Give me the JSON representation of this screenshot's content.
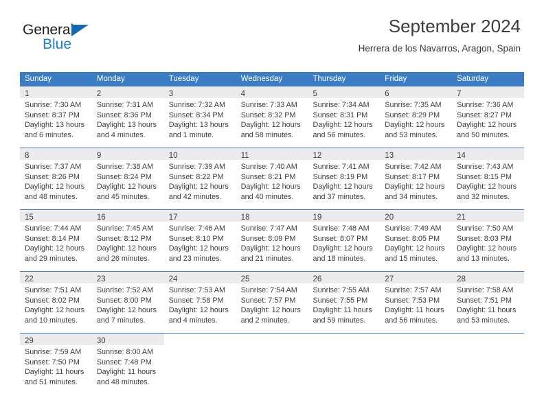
{
  "brand": {
    "name_part1": "General",
    "name_part2": "Blue",
    "triangle_color": "#1268b3",
    "blue_color": "#1b7fd4"
  },
  "header": {
    "title": "September 2024",
    "subtitle": "Herrera de los Navarros, Aragon, Spain"
  },
  "theme": {
    "header_bg": "#3b7dc4",
    "daynum_bg": "#ebebeb",
    "text": "#3d3d3d"
  },
  "weekdays": [
    "Sunday",
    "Monday",
    "Tuesday",
    "Wednesday",
    "Thursday",
    "Friday",
    "Saturday"
  ],
  "weeks": [
    [
      {
        "day": "1",
        "sunrise": "Sunrise: 7:30 AM",
        "sunset": "Sunset: 8:37 PM",
        "daylight1": "Daylight: 13 hours",
        "daylight2": "and 6 minutes."
      },
      {
        "day": "2",
        "sunrise": "Sunrise: 7:31 AM",
        "sunset": "Sunset: 8:36 PM",
        "daylight1": "Daylight: 13 hours",
        "daylight2": "and 4 minutes."
      },
      {
        "day": "3",
        "sunrise": "Sunrise: 7:32 AM",
        "sunset": "Sunset: 8:34 PM",
        "daylight1": "Daylight: 13 hours",
        "daylight2": "and 1 minute."
      },
      {
        "day": "4",
        "sunrise": "Sunrise: 7:33 AM",
        "sunset": "Sunset: 8:32 PM",
        "daylight1": "Daylight: 12 hours",
        "daylight2": "and 58 minutes."
      },
      {
        "day": "5",
        "sunrise": "Sunrise: 7:34 AM",
        "sunset": "Sunset: 8:31 PM",
        "daylight1": "Daylight: 12 hours",
        "daylight2": "and 56 minutes."
      },
      {
        "day": "6",
        "sunrise": "Sunrise: 7:35 AM",
        "sunset": "Sunset: 8:29 PM",
        "daylight1": "Daylight: 12 hours",
        "daylight2": "and 53 minutes."
      },
      {
        "day": "7",
        "sunrise": "Sunrise: 7:36 AM",
        "sunset": "Sunset: 8:27 PM",
        "daylight1": "Daylight: 12 hours",
        "daylight2": "and 50 minutes."
      }
    ],
    [
      {
        "day": "8",
        "sunrise": "Sunrise: 7:37 AM",
        "sunset": "Sunset: 8:26 PM",
        "daylight1": "Daylight: 12 hours",
        "daylight2": "and 48 minutes."
      },
      {
        "day": "9",
        "sunrise": "Sunrise: 7:38 AM",
        "sunset": "Sunset: 8:24 PM",
        "daylight1": "Daylight: 12 hours",
        "daylight2": "and 45 minutes."
      },
      {
        "day": "10",
        "sunrise": "Sunrise: 7:39 AM",
        "sunset": "Sunset: 8:22 PM",
        "daylight1": "Daylight: 12 hours",
        "daylight2": "and 42 minutes."
      },
      {
        "day": "11",
        "sunrise": "Sunrise: 7:40 AM",
        "sunset": "Sunset: 8:21 PM",
        "daylight1": "Daylight: 12 hours",
        "daylight2": "and 40 minutes."
      },
      {
        "day": "12",
        "sunrise": "Sunrise: 7:41 AM",
        "sunset": "Sunset: 8:19 PM",
        "daylight1": "Daylight: 12 hours",
        "daylight2": "and 37 minutes."
      },
      {
        "day": "13",
        "sunrise": "Sunrise: 7:42 AM",
        "sunset": "Sunset: 8:17 PM",
        "daylight1": "Daylight: 12 hours",
        "daylight2": "and 34 minutes."
      },
      {
        "day": "14",
        "sunrise": "Sunrise: 7:43 AM",
        "sunset": "Sunset: 8:15 PM",
        "daylight1": "Daylight: 12 hours",
        "daylight2": "and 32 minutes."
      }
    ],
    [
      {
        "day": "15",
        "sunrise": "Sunrise: 7:44 AM",
        "sunset": "Sunset: 8:14 PM",
        "daylight1": "Daylight: 12 hours",
        "daylight2": "and 29 minutes."
      },
      {
        "day": "16",
        "sunrise": "Sunrise: 7:45 AM",
        "sunset": "Sunset: 8:12 PM",
        "daylight1": "Daylight: 12 hours",
        "daylight2": "and 26 minutes."
      },
      {
        "day": "17",
        "sunrise": "Sunrise: 7:46 AM",
        "sunset": "Sunset: 8:10 PM",
        "daylight1": "Daylight: 12 hours",
        "daylight2": "and 23 minutes."
      },
      {
        "day": "18",
        "sunrise": "Sunrise: 7:47 AM",
        "sunset": "Sunset: 8:09 PM",
        "daylight1": "Daylight: 12 hours",
        "daylight2": "and 21 minutes."
      },
      {
        "day": "19",
        "sunrise": "Sunrise: 7:48 AM",
        "sunset": "Sunset: 8:07 PM",
        "daylight1": "Daylight: 12 hours",
        "daylight2": "and 18 minutes."
      },
      {
        "day": "20",
        "sunrise": "Sunrise: 7:49 AM",
        "sunset": "Sunset: 8:05 PM",
        "daylight1": "Daylight: 12 hours",
        "daylight2": "and 15 minutes."
      },
      {
        "day": "21",
        "sunrise": "Sunrise: 7:50 AM",
        "sunset": "Sunset: 8:03 PM",
        "daylight1": "Daylight: 12 hours",
        "daylight2": "and 13 minutes."
      }
    ],
    [
      {
        "day": "22",
        "sunrise": "Sunrise: 7:51 AM",
        "sunset": "Sunset: 8:02 PM",
        "daylight1": "Daylight: 12 hours",
        "daylight2": "and 10 minutes."
      },
      {
        "day": "23",
        "sunrise": "Sunrise: 7:52 AM",
        "sunset": "Sunset: 8:00 PM",
        "daylight1": "Daylight: 12 hours",
        "daylight2": "and 7 minutes."
      },
      {
        "day": "24",
        "sunrise": "Sunrise: 7:53 AM",
        "sunset": "Sunset: 7:58 PM",
        "daylight1": "Daylight: 12 hours",
        "daylight2": "and 4 minutes."
      },
      {
        "day": "25",
        "sunrise": "Sunrise: 7:54 AM",
        "sunset": "Sunset: 7:57 PM",
        "daylight1": "Daylight: 12 hours",
        "daylight2": "and 2 minutes."
      },
      {
        "day": "26",
        "sunrise": "Sunrise: 7:55 AM",
        "sunset": "Sunset: 7:55 PM",
        "daylight1": "Daylight: 11 hours",
        "daylight2": "and 59 minutes."
      },
      {
        "day": "27",
        "sunrise": "Sunrise: 7:57 AM",
        "sunset": "Sunset: 7:53 PM",
        "daylight1": "Daylight: 11 hours",
        "daylight2": "and 56 minutes."
      },
      {
        "day": "28",
        "sunrise": "Sunrise: 7:58 AM",
        "sunset": "Sunset: 7:51 PM",
        "daylight1": "Daylight: 11 hours",
        "daylight2": "and 53 minutes."
      }
    ],
    [
      {
        "day": "29",
        "sunrise": "Sunrise: 7:59 AM",
        "sunset": "Sunset: 7:50 PM",
        "daylight1": "Daylight: 11 hours",
        "daylight2": "and 51 minutes."
      },
      {
        "day": "30",
        "sunrise": "Sunrise: 8:00 AM",
        "sunset": "Sunset: 7:48 PM",
        "daylight1": "Daylight: 11 hours",
        "daylight2": "and 48 minutes."
      },
      {
        "day": "",
        "sunrise": "",
        "sunset": "",
        "daylight1": "",
        "daylight2": ""
      },
      {
        "day": "",
        "sunrise": "",
        "sunset": "",
        "daylight1": "",
        "daylight2": ""
      },
      {
        "day": "",
        "sunrise": "",
        "sunset": "",
        "daylight1": "",
        "daylight2": ""
      },
      {
        "day": "",
        "sunrise": "",
        "sunset": "",
        "daylight1": "",
        "daylight2": ""
      },
      {
        "day": "",
        "sunrise": "",
        "sunset": "",
        "daylight1": "",
        "daylight2": ""
      }
    ]
  ]
}
